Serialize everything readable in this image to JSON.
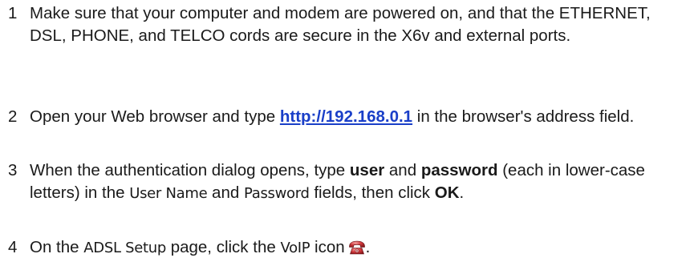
{
  "steps": [
    {
      "number": "1",
      "text": "Make sure that your computer and modem are powered on, and that the ETHERNET, DSL, PHONE, and TELCO cords are secure in the X6v and external ports."
    },
    {
      "number": "2",
      "text_before": "Open your Web browser and type ",
      "link": "http://192.168.0.1",
      "text_after": " in the browser's address field."
    },
    {
      "number": "3",
      "text_1": "When the authentication dialog opens, type ",
      "bold_user": "user",
      "text_2": " and ",
      "bold_password": "password",
      "text_3": " (each in lower-case letters) in the ",
      "field_user_name": "User Name",
      "text_4": " and ",
      "field_password": "Password",
      "text_5": " fields, then click ",
      "bold_ok": "OK",
      "text_6": "."
    },
    {
      "number": "4",
      "text_1": "On the ",
      "page_name": "ADSL Setup",
      "text_2": " page, click the ",
      "icon_label": "VoIP",
      "text_3": " icon",
      "text_4": ".",
      "icon": "voip-phone-icon",
      "icon_color": "#c0282d"
    }
  ]
}
